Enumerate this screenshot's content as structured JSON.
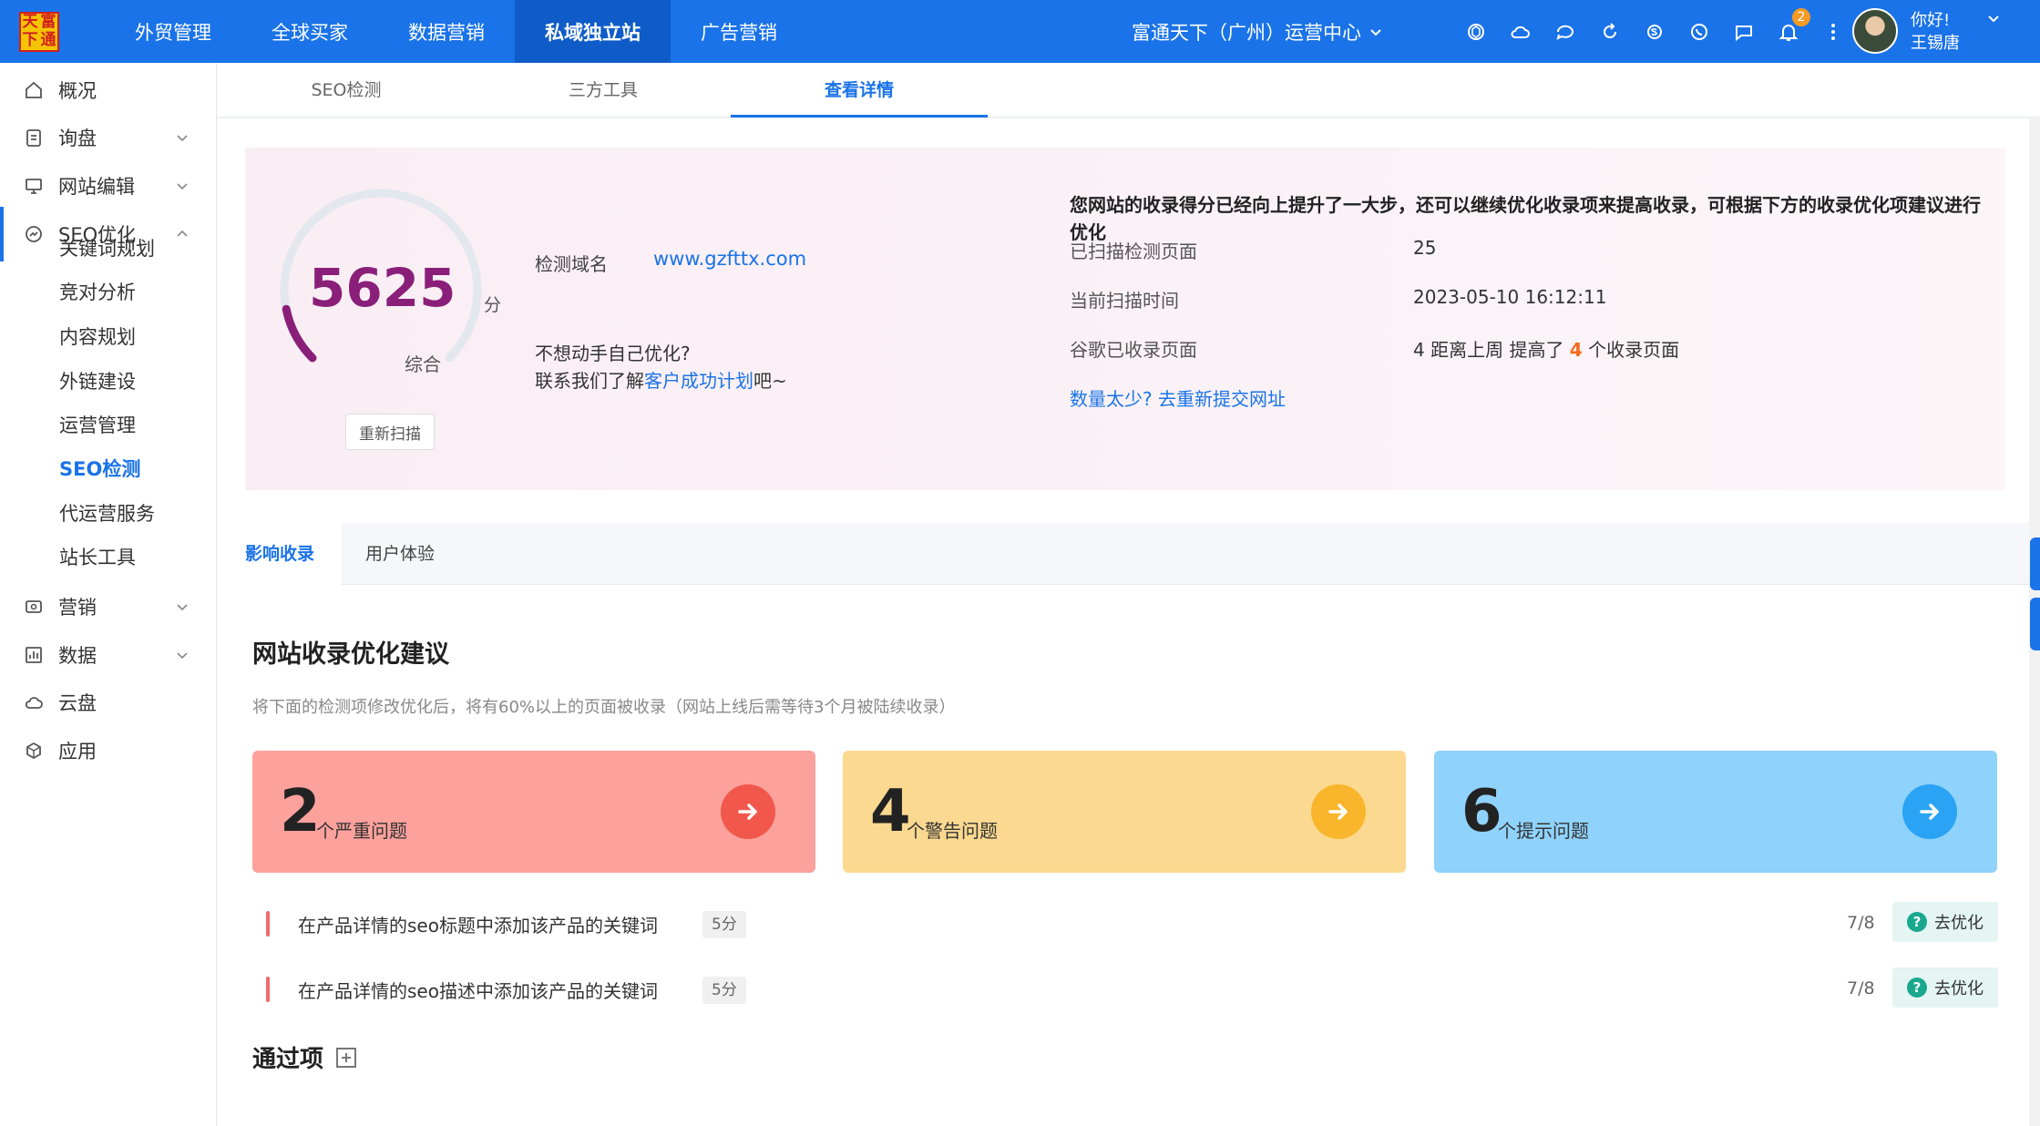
{
  "logo": {
    "chars": [
      "天",
      "富",
      "下",
      "通"
    ]
  },
  "nav": [
    {
      "label": "外贸管理"
    },
    {
      "label": "全球买家"
    },
    {
      "label": "数据营销"
    },
    {
      "label": "私域独立站",
      "active": true
    },
    {
      "label": "广告营销"
    }
  ],
  "org": {
    "label": "富通天下（广州）运营中心"
  },
  "notifications": {
    "count": "2"
  },
  "user": {
    "greeting": "你好!",
    "name": "王锡唐"
  },
  "sidebar": {
    "items": [
      {
        "label": "概况",
        "icon": "home-icon"
      },
      {
        "label": "询盘",
        "icon": "clipboard-icon"
      },
      {
        "label": "网站编辑",
        "icon": "monitor-icon"
      },
      {
        "label": "SEO优化",
        "icon": "seo-icon"
      },
      {
        "label": "营销",
        "icon": "marketing-icon"
      },
      {
        "label": "数据",
        "icon": "chart-icon"
      },
      {
        "label": "云盘",
        "icon": "cloud-icon"
      },
      {
        "label": "应用",
        "icon": "app-icon"
      }
    ],
    "seo_sub": [
      "关键词规划",
      "竞对分析",
      "内容规划",
      "外链建设",
      "运营管理",
      "SEO检测",
      "代运营服务",
      "站长工具"
    ],
    "seo_sub_active": "SEO检测"
  },
  "tabs": [
    "SEO检测",
    "三方工具",
    "查看详情"
  ],
  "active_tab": "查看详情",
  "summary": {
    "score": "5625",
    "score_max": 10000,
    "score_unit": "分",
    "score_label": "综合",
    "rescan": "重新扫描",
    "domain_label": "检测域名",
    "domain": "www.gzfttx.com",
    "help_line1": "不想动手自己优化?",
    "help_prefix": "联系我们了解",
    "help_link": "客户成功计划",
    "help_suffix": "吧~",
    "advice": "您网站的收录得分已经向上提升了一大步，还可以继续优化收录项来提高收录，可根据下方的收录优化项建议进行优化",
    "stats": [
      {
        "label": "已扫描检测页面",
        "value": "25"
      },
      {
        "label": "当前扫描时间",
        "value": "2023-05-10 16:12:11"
      },
      {
        "label": "谷歌已收录页面",
        "value_prefix": "4 距离上周 提高了 ",
        "value_highlight": "4",
        "value_suffix": " 个收录页面"
      }
    ],
    "resubmit": "数量太少? 去重新提交网址"
  },
  "subtabs": [
    "影响收录",
    "用户体验"
  ],
  "section": {
    "title": "网站收录优化建议",
    "desc": "将下面的检测项修改优化后，将有60%以上的页面被收录（网站上线后需等待3个月被陆续收录）"
  },
  "cards": [
    {
      "count": "2",
      "label": "个严重问题",
      "bg": "#fca19c",
      "arrow": "#f2574c"
    },
    {
      "count": "4",
      "label": "个警告问题",
      "bg": "#fcd990",
      "arrow": "#f9b52c"
    },
    {
      "count": "6",
      "label": "个提示问题",
      "bg": "#8fd2fb",
      "arrow": "#2aa3f4"
    }
  ],
  "issues": [
    {
      "text": "在产品详情的seo标题中添加该产品的关键词",
      "points": "5分",
      "ratio": "7/8",
      "action": "去优化"
    },
    {
      "text": "在产品详情的seo描述中添加该产品的关键词",
      "points": "5分",
      "ratio": "7/8",
      "action": "去优化"
    }
  ],
  "pass": {
    "title": "通过项"
  }
}
